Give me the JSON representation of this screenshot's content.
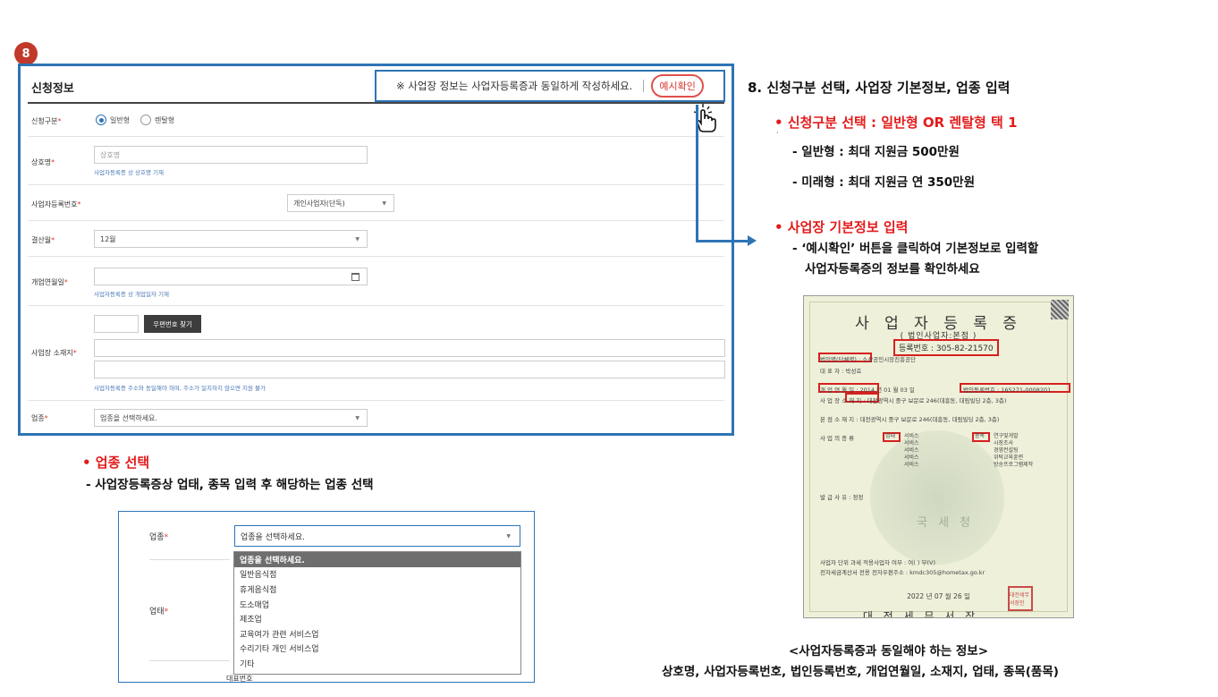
{
  "step_badge": "8",
  "form": {
    "title": "신청정보",
    "notice": "※ 사업장 정보는 사업자등록증과 동일하게 작성하세요.",
    "example_button": "예시확인",
    "fields": {
      "application_type": {
        "label": "신청구분",
        "options": [
          "일반형",
          "렌탈형"
        ],
        "selected": "일반형"
      },
      "business_name": {
        "label": "상호명",
        "placeholder": "상호명",
        "help": "사업자등록증 상 상호명 기재"
      },
      "registration_no": {
        "label": "사업자등록번호",
        "value": "개인사업자(단독)"
      },
      "settlement_month": {
        "label": "결산월",
        "value": "12월"
      },
      "opening_date": {
        "label": "개업연월일",
        "help": "사업자등록증 상 개업일자 기재"
      },
      "address": {
        "label": "사업장 소재지",
        "zip_button": "우편번호 찾기",
        "help": "사업자등록증 주소와 동일해야 하며, 주소가 일치하지 않으면 지원 불가"
      },
      "industry": {
        "label": "업종",
        "value": "업종을 선택하세요."
      }
    },
    "required_mark": "*"
  },
  "right_panel": {
    "heading": "8. 신청구분 선택, 사업장 기본정보, 업종 입력",
    "bullet1": "•  신청구분 선택  : 일반형 OR 렌탈형 택 1",
    "line1": "- 일반형 : 최대 지원금 500만원",
    "line2": "- 미래형 : 최대 지원금 연 350만원",
    "bullet2": "•  사업장 기본정보 입력",
    "line3": "- ‘예시확인’ 버튼을 클릭하여 기본정보로 입력할",
    "line4": "사업자등록증의 정보를 확인하세요"
  },
  "certificate": {
    "title": "사 업 자 등 록 증",
    "subtitle": "( 법인사업자:본점 )",
    "reg_no": "등록번호 : 305-82-21570",
    "corp_name": "법인명(단체명) : 소상공인시장진흥공단",
    "rep": "대      표      자 : 박성효",
    "open_date": "개 업 연 월 일 : 2014 년 01 월 03 일",
    "corp_reg": "법인등록번호 : 165271-0008201",
    "location": "사 업 장 소 재 지 : 대전광역시 중구 보문로 246(대흥동, 대림빌딩 2층, 3층)",
    "hq_location": "본 점 소 재 지 : 대전광역시 중구 보문로 246(대흥동, 대림빌딩 2층, 3층)",
    "biz_type_label": "사 업 의 종 류",
    "biz_type_tag": "업태",
    "biz_types": "서비스\n서비스\n서비스\n서비스\n서비스",
    "item_tag": "종목",
    "items": "연구및개발\n시장조사\n경영컨설팅\n위탁교육훈련\n방송프로그램제작",
    "issue_reason": "발 급 사 유 : 정정",
    "seal_text": "국 세 청",
    "tax_line": "사업자 단위 과세 적용사업자 여부 :  여(  ) 부(V)",
    "email_line": "전자세금계산서 전용 전자우편주소 : kmdc305@hometax.go.kr",
    "date": "2022 년 07 월 26 일",
    "issuer": "대 전 세 무 서 장",
    "stamp": "대전세무서장인"
  },
  "captions": {
    "cert_title": "<사업자등록증과 동일해야 하는 정보>",
    "cert_list": "상호명, 사업자등록번호, 법인등록번호, 개업연월일, 소재지, 업태, 종목(품목)",
    "industry_bullet": "•  업종 선택",
    "industry_desc": "- 사업장등록증상 업태, 종목 입력 후 해당하는 업종 선택"
  },
  "dropdown_demo": {
    "label_industry": "업종",
    "label_biz": "업태",
    "label_partial": "대표번호",
    "select_value": "업종을 선택하세요.",
    "options": [
      "업종을 선택하세요.",
      "일반음식점",
      "휴게음식점",
      "도소매업",
      "제조업",
      "교육여가 관련 서비스업",
      "수리기타 개인 서비스업",
      "기타"
    ],
    "selected_index": 0
  },
  "colors": {
    "accent": "#2e74b5",
    "red": "#e31b1b",
    "badge": "#c0392b"
  }
}
